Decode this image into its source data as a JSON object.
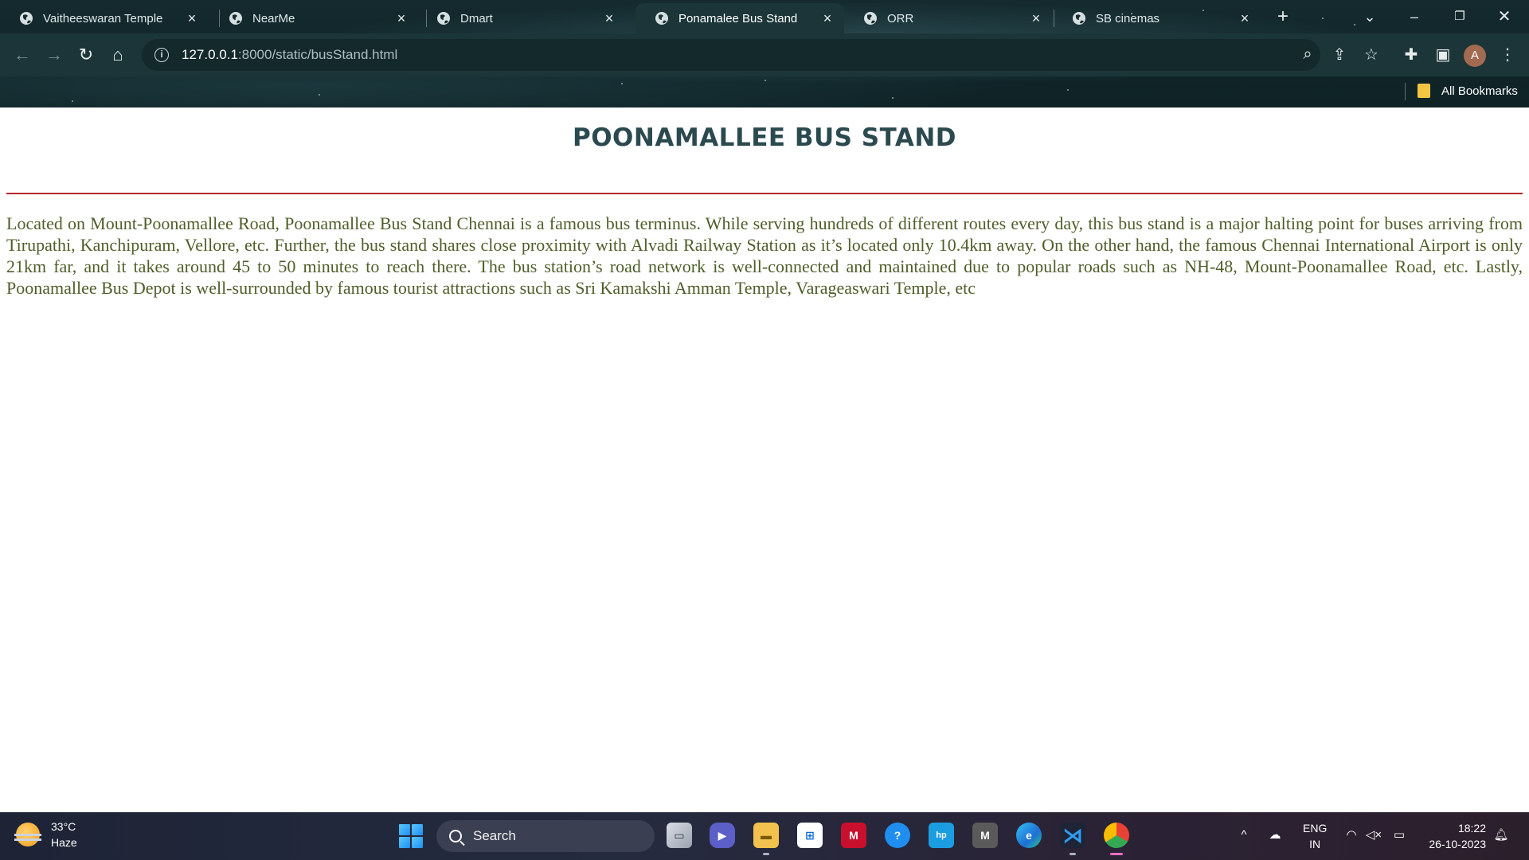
{
  "browser": {
    "tabs": [
      {
        "title": "Vaitheeswaran Temple",
        "active": false
      },
      {
        "title": "NearMe",
        "active": false
      },
      {
        "title": "Dmart",
        "active": false
      },
      {
        "title": "Ponamalee Bus Stand",
        "active": true
      },
      {
        "title": "ORR",
        "active": false
      },
      {
        "title": "SB cinemas",
        "active": false
      }
    ],
    "url_host": "127.0.0.1",
    "url_rest": ":8000/static/busStand.html",
    "profile_initial": "A",
    "bookmarks_folder": "All Bookmarks"
  },
  "page": {
    "title": "POONAMALLEE BUS STAND",
    "description": "Located on Mount-Poonamallee Road, Poonamallee Bus Stand Chennai is a famous bus terminus. While serving hundreds of different routes every day, this bus stand is a major halting point for buses arriving from Tirupathi, Kanchipuram, Vellore, etc. Further, the bus stand shares close proximity with Alvadi Railway Station as it’s located only 10.4km away. On the other hand, the famous Chennai International Airport is only 21km far, and it takes around 45 to 50 minutes to reach there. The bus station’s road network is well-connected and maintained due to popular roads such as NH-48, Mount-Poonamallee Road, etc. Lastly, Poonamallee Bus Depot is well-surrounded by famous tourist attractions such as Sri Kamakshi Amman Temple, Varageaswari Temple, etc",
    "colors": {
      "title": "#2b4a4f",
      "divider": "#b3262a",
      "body_text": "#4f5e2a"
    }
  },
  "taskbar": {
    "weather_temp": "33°C",
    "weather_desc": "Haze",
    "search_label": "Search",
    "lang_line1": "ENG",
    "lang_line2": "IN",
    "time": "18:22",
    "date": "26-10-2023"
  }
}
